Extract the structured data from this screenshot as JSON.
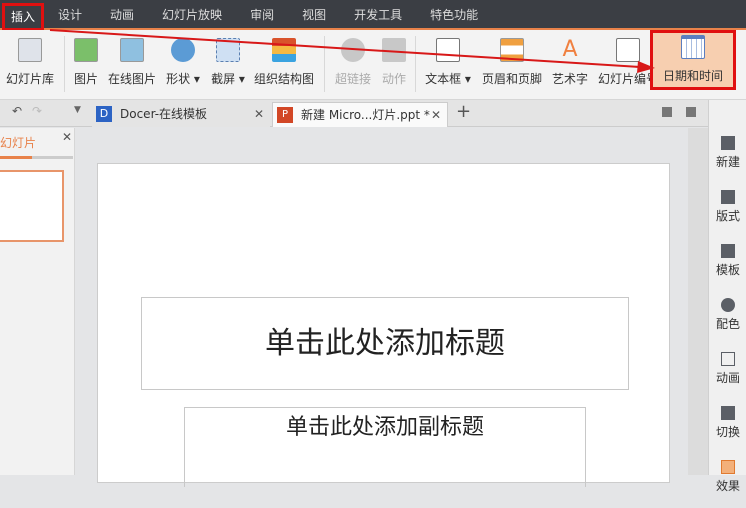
{
  "menu": [
    "插入",
    "设计",
    "动画",
    "幻灯片放映",
    "审阅",
    "视图",
    "开发工具",
    "特色功能"
  ],
  "ribbon": {
    "slide_library": "幻灯片库",
    "picture": "图片",
    "online_picture": "在线图片",
    "shape": "形状",
    "screenshot": "截屏",
    "org_chart": "组织结构图",
    "hyperlink": "超链接",
    "action": "动作",
    "textbox": "文本框",
    "header_footer": "页眉和页脚",
    "wordart": "艺术字",
    "slide_number": "幻灯片编号",
    "date_time": "日期和时间"
  },
  "tabs": [
    {
      "label": "Docer-在线模板"
    },
    {
      "label": "新建 Micro...灯片.ppt *"
    }
  ],
  "left_panel": {
    "tab": "幻灯片"
  },
  "slide": {
    "title_placeholder": "单击此处添加标题",
    "subtitle_placeholder": "单击此处添加副标题"
  },
  "right_tools": [
    "新建",
    "版式",
    "模板",
    "配色",
    "动画",
    "切换",
    "效果"
  ],
  "colors": {
    "accent": "#e8824a",
    "highlight": "#e01010"
  }
}
